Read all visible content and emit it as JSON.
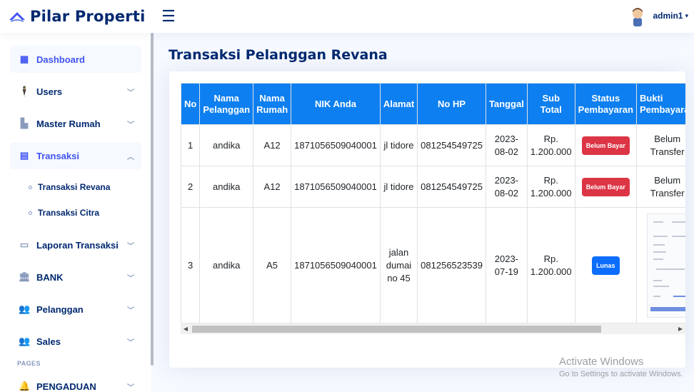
{
  "header": {
    "brand": "Pilar Properti",
    "username": "admin1"
  },
  "sidebar": {
    "items": [
      {
        "label": "Dashboard",
        "icon": "grid-icon",
        "active": true
      },
      {
        "label": "Users",
        "icon": "user-icon"
      },
      {
        "label": "Master Rumah",
        "icon": "building-icon"
      },
      {
        "label": "Transaksi",
        "icon": "receipt-icon",
        "expanded": true
      }
    ],
    "sub_items": [
      "Transaksi Revana",
      "Transaksi Citra"
    ],
    "items_after": [
      {
        "label": "Laporan Transaksi",
        "icon": "folder-icon"
      },
      {
        "label": "BANK",
        "icon": "bank-icon"
      },
      {
        "label": "Pelanggan",
        "icon": "people-icon"
      },
      {
        "label": "Sales",
        "icon": "people-icon"
      }
    ],
    "section_heading": "PAGES",
    "pages": [
      {
        "label": "PENGADUAN",
        "icon": "bell-icon"
      }
    ]
  },
  "main": {
    "title": "Transaksi Pelanggan Revana",
    "table": {
      "headers": [
        "No",
        "Nama Pelanggan",
        "Nama Rumah",
        "NIK Anda",
        "Alamat",
        "No HP",
        "Tanggal",
        "Sub Total",
        "Status Pembayaran",
        "Bukti Pembayaran"
      ],
      "rows": [
        {
          "no": "1",
          "nama": "andika",
          "rumah": "A12",
          "nik": "1871056509040001",
          "alamat": "jl tidore",
          "hp": "081254549725",
          "tanggal": "2023-08-02",
          "subtotal": "Rp. 1.200.000",
          "status": "Belum Bayar",
          "bukti": "Belum Transfer"
        },
        {
          "no": "2",
          "nama": "andika",
          "rumah": "A12",
          "nik": "1871056509040001",
          "alamat": "jl tidore",
          "hp": "081254549725",
          "tanggal": "2023-08-02",
          "subtotal": "Rp. 1.200.000",
          "status": "Belum Bayar",
          "bukti": "Belum Transfer"
        },
        {
          "no": "3",
          "nama": "andika",
          "rumah": "A5",
          "nik": "1871056509040001",
          "alamat": "jalan dumai no 45",
          "hp": "081256523539",
          "tanggal": "2023-07-19",
          "subtotal": "Rp. 1.200.000",
          "status": "Lunas",
          "bukti": ""
        }
      ]
    }
  },
  "watermark": {
    "title": "Activate Windows",
    "subtitle": "Go to Settings to activate Windows."
  },
  "colors": {
    "brand": "#012970",
    "accent": "#4154f1",
    "table_header": "#0d7ff0",
    "badge_unpaid": "#dc3545",
    "badge_paid": "#0d6efd"
  }
}
